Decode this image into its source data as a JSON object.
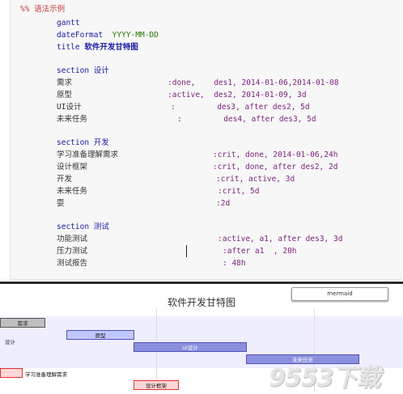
{
  "code": {
    "comment": "%% 语法示例",
    "gantt_kw": "gantt",
    "dateFormat_kw": "dateFormat",
    "dateFormat_val": "YYYY-MM-DD",
    "title_kw": "title",
    "title_val": "软件开发甘特图",
    "section_kw": "section",
    "sections": [
      {
        "name": "设计",
        "tasks": [
          {
            "name": "需求",
            "spec": ":done,    des1, 2014-01-06,2014-01-08"
          },
          {
            "name": "原型",
            "spec": ":active,  des2, 2014-01-09, 3d"
          },
          {
            "name": "UI设计",
            "spec": ":         des3, after des2, 5d"
          },
          {
            "name": "未来任务",
            "spec": ":         des4, after des3, 5d"
          }
        ]
      },
      {
        "name": "开发",
        "tasks": [
          {
            "name": "学习准备理解需求",
            "spec": ":crit, done, 2014-01-06,24h"
          },
          {
            "name": "设计框架",
            "spec": ":crit, done, after des2, 2d"
          },
          {
            "name": "开发",
            "spec": ":crit, active, 3d"
          },
          {
            "name": "未来任务",
            "spec": ":crit, 5d"
          },
          {
            "name": "耍",
            "spec": ":2d"
          }
        ]
      },
      {
        "name": "测试",
        "tasks": [
          {
            "name": "功能测试",
            "spec": ":active, a1, after des3, 3d"
          },
          {
            "name": "压力测试",
            "spec": ":after a1  , 20h"
          },
          {
            "name": "测试报告",
            "spec": ": 48h"
          }
        ]
      }
    ]
  },
  "preview": {
    "title": "软件开发甘特图",
    "badge": "mermaid",
    "section_label": "设计",
    "bars": {
      "req": "需求",
      "proto": "原型",
      "ui": "UI设计",
      "future": "未来任务",
      "design_fw": "设计框架"
    },
    "learn_label": "学习准备理解需求"
  },
  "watermark": "9553下载",
  "colors": {
    "done": "#bfbfbf",
    "active": "#bfc7ff",
    "normal": "#8a90dd",
    "crit": "#ffd7d7",
    "section_band": "#eeeeff"
  }
}
